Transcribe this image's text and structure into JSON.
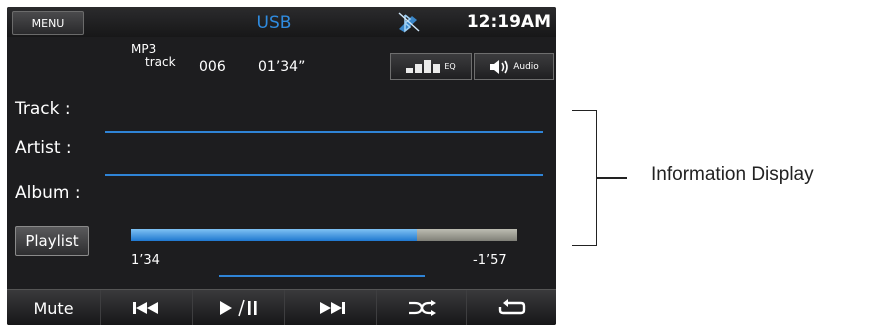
{
  "status_bar": {
    "menu_label": "MENU",
    "source": "USB",
    "clock": "12:19AM",
    "bluetooth_icon": "bluetooth-disabled-icon"
  },
  "track_info": {
    "format_line1": "MP3",
    "format_line2": "track",
    "track_number": "006",
    "elapsed": "01’34”"
  },
  "buttons": {
    "eq_label": "EQ",
    "audio_label": "Audio"
  },
  "fields": [
    {
      "label": "Track  :"
    },
    {
      "label": "Artist  :"
    },
    {
      "label": "Album :"
    }
  ],
  "playlist_label": "Playlist",
  "progress": {
    "elapsed": "1’34",
    "remaining": "-1’57",
    "fraction": 0.74
  },
  "controls": [
    {
      "label": "Mute",
      "icon": "mute-label"
    },
    {
      "label": "",
      "icon": "previous-track-icon"
    },
    {
      "label": "",
      "icon": "play-pause-icon"
    },
    {
      "label": "",
      "icon": "next-track-icon"
    },
    {
      "label": "",
      "icon": "shuffle-icon"
    },
    {
      "label": "",
      "icon": "repeat-icon"
    }
  ],
  "callout": {
    "label": "Information Display"
  },
  "colors": {
    "accent": "#2f84d6",
    "screen_bg": "#1d1d1f",
    "progress_fill": "#1f78d0"
  }
}
